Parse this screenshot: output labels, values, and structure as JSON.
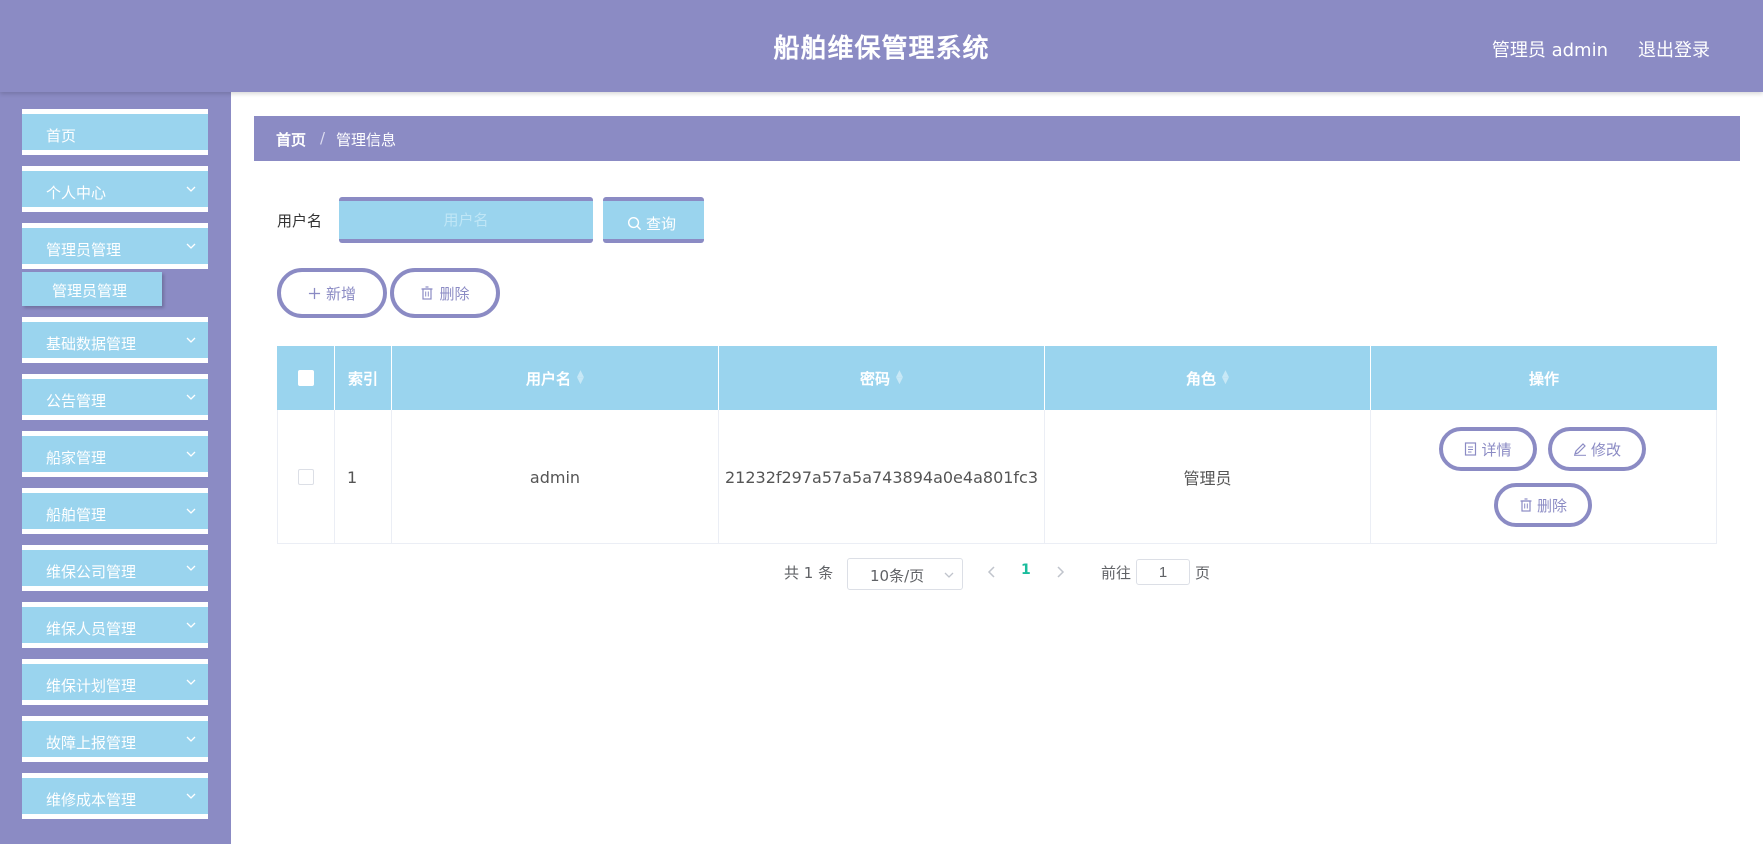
{
  "header": {
    "title": "船舶维保管理系统",
    "user": "管理员 admin",
    "logout": "退出登录"
  },
  "sidebar": {
    "items": [
      {
        "label": "首页"
      },
      {
        "label": "个人中心"
      },
      {
        "label": "管理员管理"
      },
      {
        "label": "基础数据管理"
      },
      {
        "label": "公告管理"
      },
      {
        "label": "船家管理"
      },
      {
        "label": "船舶管理"
      },
      {
        "label": "维保公司管理"
      },
      {
        "label": "维保人员管理"
      },
      {
        "label": "维保计划管理"
      },
      {
        "label": "故障上报管理"
      },
      {
        "label": "维修成本管理"
      }
    ],
    "submenu": {
      "label": "管理员管理"
    }
  },
  "breadcrumb": {
    "home": "首页",
    "separator": "/",
    "current": "管理信息"
  },
  "search": {
    "label": "用户名",
    "placeholder": "用户名",
    "query_label": "查询"
  },
  "actions": {
    "add_label": "新增",
    "delete_label": "删除"
  },
  "table": {
    "columns": [
      "索引",
      "用户名",
      "密码",
      "角色",
      "操作"
    ],
    "rows": [
      {
        "index": "1",
        "username": "admin",
        "password": "21232f297a57a5a743894a0e4a801fc3",
        "role": "管理员"
      }
    ],
    "row_actions": {
      "detail": "详情",
      "edit": "修改",
      "delete": "删除"
    }
  },
  "pagination": {
    "total": "共 1 条",
    "page_size": "10条/页",
    "current_page": "1",
    "goto_label": "前往",
    "goto_value": "1",
    "page_suffix": "页"
  },
  "colors": {
    "primary": "#8b8bc4",
    "accent": "#9ad4ee",
    "page_active": "#1abc9c"
  }
}
